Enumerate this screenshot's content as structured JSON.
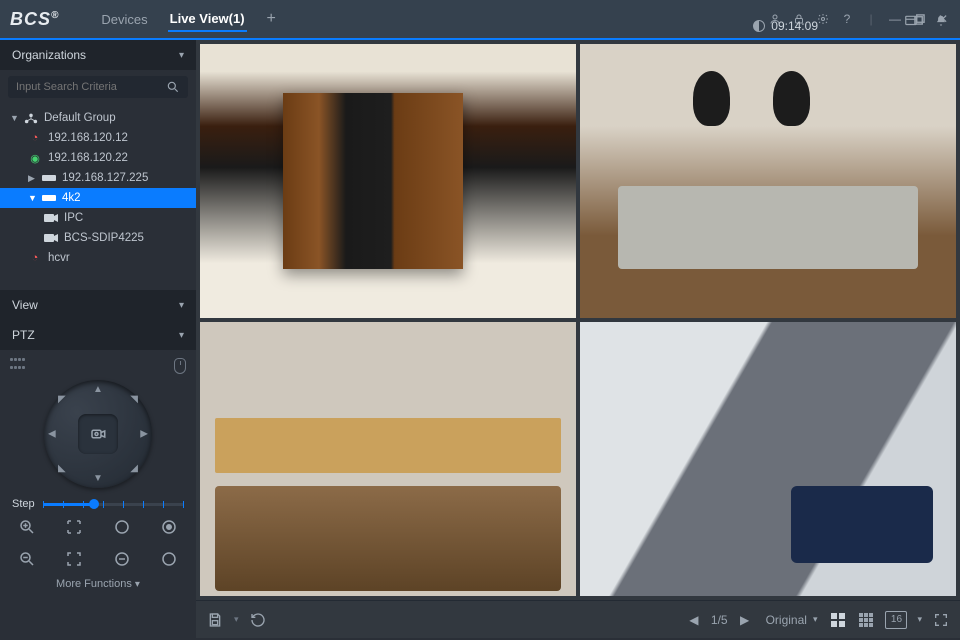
{
  "app": {
    "brand": "BCS"
  },
  "tabs": {
    "devices": "Devices",
    "live": "Live View(1)"
  },
  "clock": "09:14:09",
  "sidebar": {
    "organizations": "Organizations",
    "search_placeholder": "Input Search Criteria",
    "default_group": "Default Group",
    "items": [
      {
        "label": "192.168.120.12"
      },
      {
        "label": "192.168.120.22"
      },
      {
        "label": "192.168.127.225"
      },
      {
        "label": "4k2"
      },
      {
        "label": "IPC"
      },
      {
        "label": "BCS-SDIP4225"
      },
      {
        "label": "hcvr"
      }
    ],
    "view": "View",
    "ptz": "PTZ",
    "step": "Step",
    "more": "More Functions"
  },
  "toolbar": {
    "page": "1/5",
    "ratio": "Original",
    "layout_number": "16"
  }
}
